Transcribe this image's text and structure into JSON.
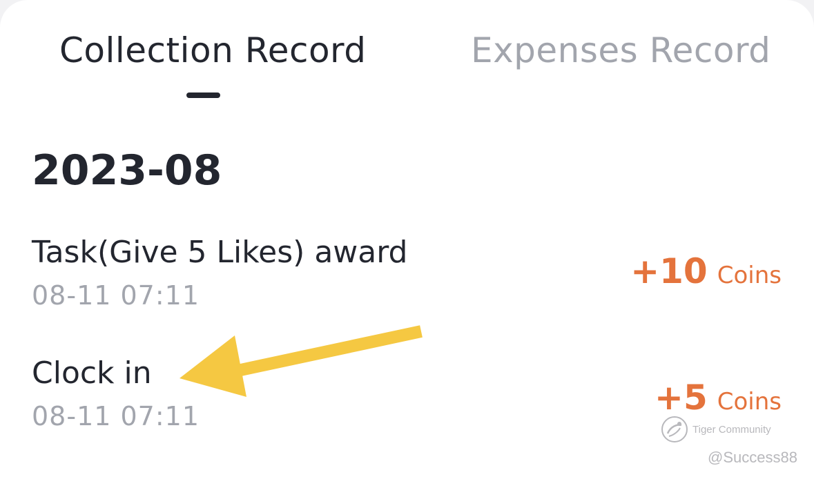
{
  "tabs": [
    {
      "label": "Collection Record",
      "active": true
    },
    {
      "label": "Expenses Record",
      "active": false
    }
  ],
  "month": "2023-08",
  "records": [
    {
      "title": "Task(Give 5 Likes) award",
      "time": "08-11 07:11",
      "amount": "+10",
      "unit": "Coins"
    },
    {
      "title": "Clock in",
      "time": "08-11 07:11",
      "amount": "+5",
      "unit": "Coins"
    }
  ],
  "watermark": {
    "brand": "Tiger Community",
    "user": "@Success88"
  },
  "colors": {
    "text_primary": "#23262f",
    "text_secondary": "#a2a5ad",
    "reward": "#e4733c",
    "annotation_arrow": "#f5c842"
  }
}
